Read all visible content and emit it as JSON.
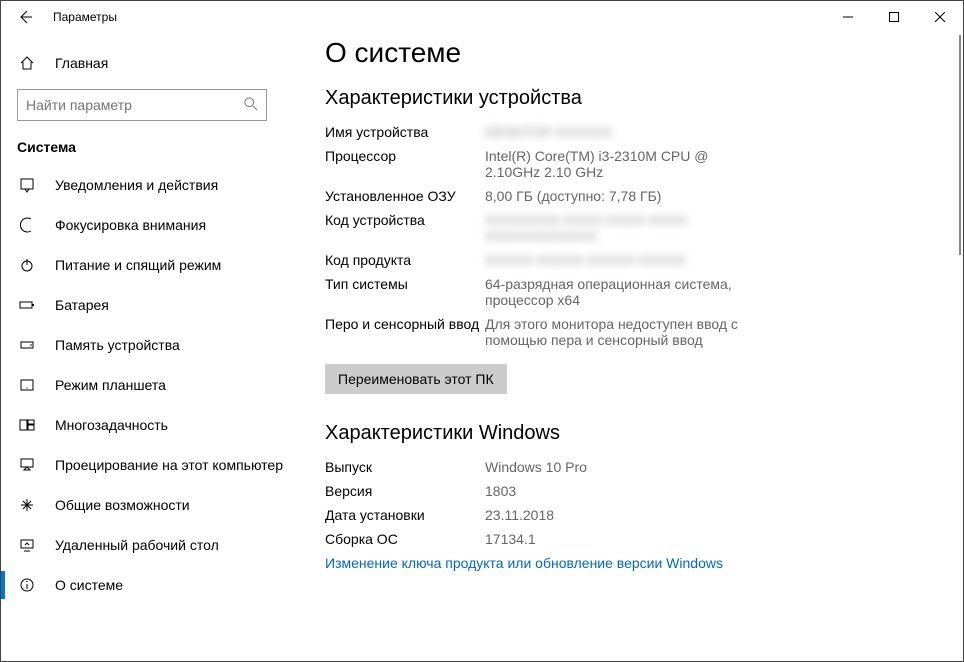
{
  "titlebar": {
    "title": "Параметры"
  },
  "sidebar": {
    "home_label": "Главная",
    "search_placeholder": "Найти параметр",
    "section_label": "Система",
    "items": [
      {
        "label": "Уведомления и действия"
      },
      {
        "label": "Фокусировка внимания"
      },
      {
        "label": "Питание и спящий режим"
      },
      {
        "label": "Батарея"
      },
      {
        "label": "Память устройства"
      },
      {
        "label": "Режим планшета"
      },
      {
        "label": "Многозадачность"
      },
      {
        "label": "Проецирование на этот компьютер"
      },
      {
        "label": "Общие возможности"
      },
      {
        "label": "Удаленный рабочий стол"
      },
      {
        "label": "О системе"
      }
    ]
  },
  "content": {
    "page_title": "О системе",
    "device_section_title": "Характеристики устройства",
    "device_specs": {
      "name_key": "Имя устройства",
      "name_val": "DESKTOP-XXXXXX",
      "cpu_key": "Процессор",
      "cpu_val": "Intel(R) Core(TM) i3-2310M CPU @ 2.10GHz   2.10 GHz",
      "ram_key": "Установленное ОЗУ",
      "ram_val": "8,00 ГБ (доступно: 7,78 ГБ)",
      "device_id_key": "Код устройства",
      "device_id_val": "XXXXXXXX-XXXX-XXXX-XXXX-XXXXXXXXXXXX",
      "product_id_key": "Код продукта",
      "product_id_val": "XXXXX-XXXXX-XXXXX-XXXXX",
      "system_type_key": "Тип системы",
      "system_type_val": "64-разрядная операционная система, процессор x64",
      "pen_key": "Перо и сенсорный ввод",
      "pen_val": "Для этого монитора недоступен ввод с помощью пера и сенсорный ввод"
    },
    "rename_button": "Переименовать этот ПК",
    "windows_section_title": "Характеристики Windows",
    "windows_specs": {
      "edition_key": "Выпуск",
      "edition_val": "Windows 10 Pro",
      "version_key": "Версия",
      "version_val": "1803",
      "install_date_key": "Дата установки",
      "install_date_val": "23.11.2018",
      "build_key": "Сборка ОС",
      "build_val": "17134.1"
    },
    "update_link": "Изменение ключа продукта или обновление версии Windows"
  }
}
